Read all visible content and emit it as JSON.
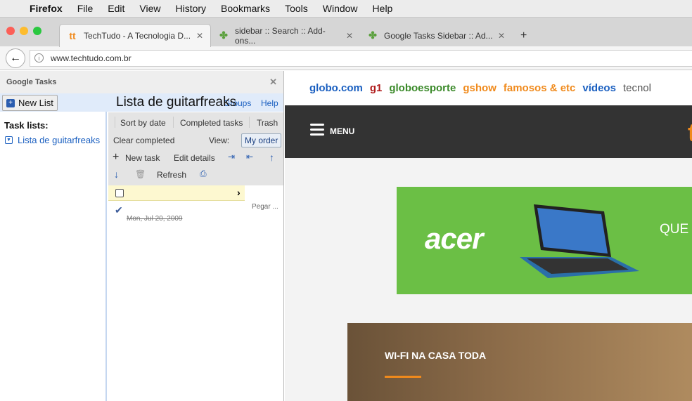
{
  "menubar": {
    "app": "Firefox",
    "items": [
      "File",
      "Edit",
      "View",
      "History",
      "Bookmarks",
      "Tools",
      "Window",
      "Help"
    ]
  },
  "tabs": [
    {
      "title": "TechTudo - A Tecnologia D...",
      "favicon": "tt"
    },
    {
      "title": "sidebar :: Search :: Add-ons..."
    },
    {
      "title": "Google Tasks Sidebar :: Ad..."
    }
  ],
  "url": "www.techtudo.com.br",
  "sidebar": {
    "title": "Google Tasks",
    "new_list": "New List",
    "list_title": "Lista de guitarfreaks",
    "groups": "Groups",
    "help": "Help",
    "task_lists_label": "Task lists:",
    "lists": [
      "Lista de guitarfreaks"
    ],
    "toolbar": {
      "sort_by_date": "Sort by date",
      "completed_tasks": "Completed tasks",
      "trash": "Trash",
      "clear_completed": "Clear completed",
      "view_label": "View:",
      "my_order": "My order",
      "new_task": "New task",
      "edit_details": "Edit details",
      "refresh": "Refresh"
    },
    "completed_task": {
      "date": "Mon, Jul 20, 2009",
      "note": "Pegar ..."
    }
  },
  "web": {
    "globo_links": [
      {
        "t": "globo.com",
        "c": "#1a5fc0"
      },
      {
        "t": "g1",
        "c": "#b01c1c"
      },
      {
        "t": "globoesporte",
        "c": "#3b8a2a"
      },
      {
        "t": "gshow",
        "c": "#f08a1c"
      },
      {
        "t": "famosos & etc",
        "c": "#f08a1c"
      },
      {
        "t": "vídeos",
        "c": "#1a5fc0"
      },
      {
        "t": "tecnol",
        "c": "#555"
      }
    ],
    "menu": "MENU",
    "logo": "t",
    "ad_brand": "acer",
    "ad_text": "QUE",
    "hero_title": "WI-FI NA CASA TODA"
  }
}
